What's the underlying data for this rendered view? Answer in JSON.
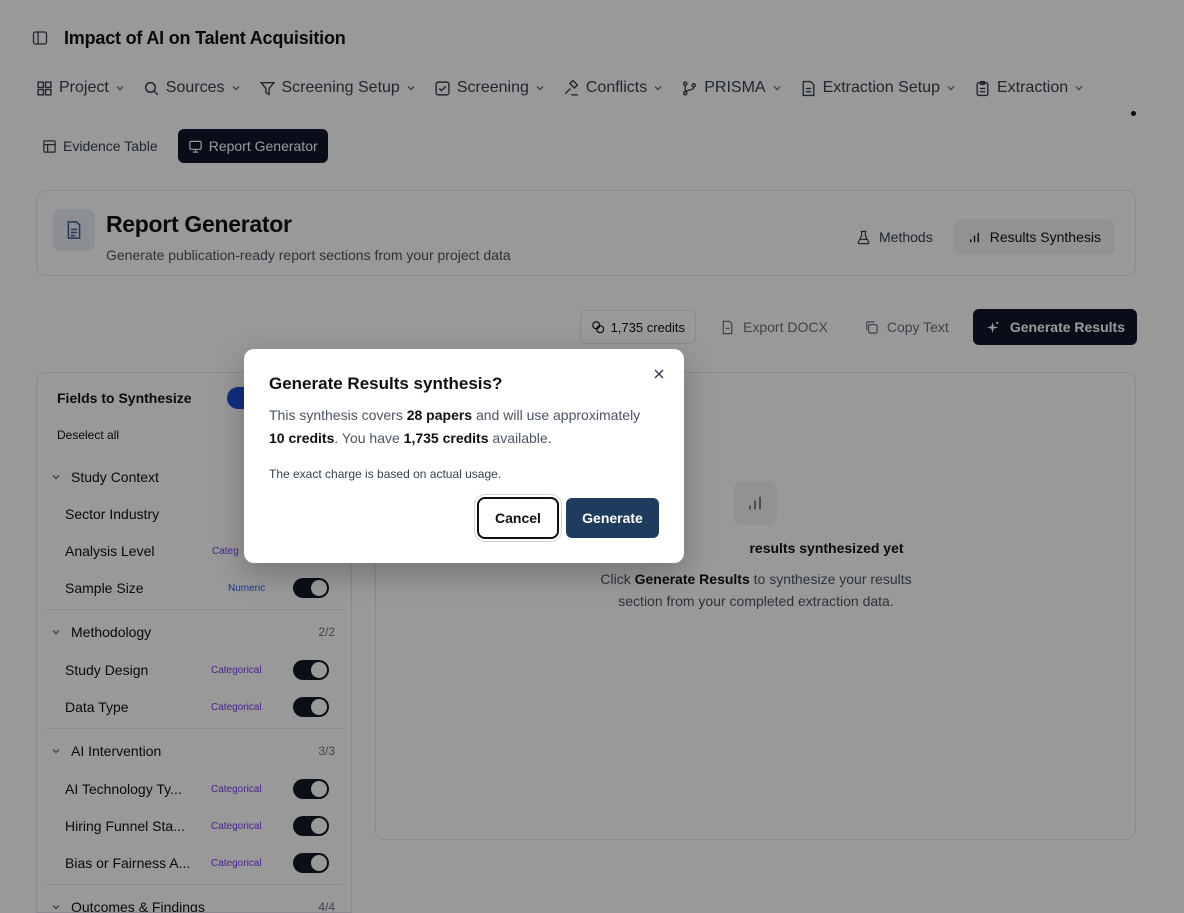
{
  "window": {
    "title": "Impact of AI on Talent Acquisition"
  },
  "nav": {
    "items": [
      {
        "label": "Project",
        "icon": "grid-icon"
      },
      {
        "label": "Sources",
        "icon": "search-icon"
      },
      {
        "label": "Screening Setup",
        "icon": "filter-icon"
      },
      {
        "label": "Screening",
        "icon": "checkbox-icon"
      },
      {
        "label": "Conflicts",
        "icon": "gavel-icon"
      },
      {
        "label": "PRISMA",
        "icon": "git-branch-icon"
      },
      {
        "label": "Extraction Setup",
        "icon": "file-text-icon"
      },
      {
        "label": "Extraction",
        "icon": "clipboard-icon"
      }
    ]
  },
  "subnav": {
    "evidence_table": "Evidence Table",
    "report_generator": "Report Generator"
  },
  "header": {
    "title": "Report Generator",
    "subtitle": "Generate publication-ready report sections from your project data",
    "tabs": [
      {
        "label": "Methods",
        "icon": "flask-icon",
        "active": false
      },
      {
        "label": "Results Synthesis",
        "icon": "bar-chart-icon",
        "active": true
      }
    ]
  },
  "toolbar": {
    "credits": "1,735 credits",
    "export": "Export DOCX",
    "copy": "Copy Text",
    "generate": "Generate Results"
  },
  "fields_panel": {
    "title": "Fields to Synthesize",
    "deselect_all": "Deselect all",
    "groups": [
      {
        "name": "Study Context",
        "count": "",
        "fields": [
          {
            "label": "Sector Industry",
            "type": ""
          },
          {
            "label": "Analysis Level",
            "type": "Categ"
          },
          {
            "label": "Sample Size",
            "type": "Numeric"
          }
        ]
      },
      {
        "name": "Methodology",
        "count": "2/2",
        "fields": [
          {
            "label": "Study Design",
            "type": "Categorical"
          },
          {
            "label": "Data Type",
            "type": "Categorical"
          }
        ]
      },
      {
        "name": "AI Intervention",
        "count": "3/3",
        "fields": [
          {
            "label": "AI Technology Ty...",
            "type": "Categorical"
          },
          {
            "label": "Hiring Funnel Sta...",
            "type": "Categorical"
          },
          {
            "label": "Bias or Fairness A...",
            "type": "Categorical"
          }
        ]
      },
      {
        "name": "Outcomes & Findings",
        "count": "4/4",
        "fields": []
      }
    ]
  },
  "empty_state": {
    "title": "results synthesized yet",
    "desc_prefix": "Click ",
    "desc_bold": "Generate Results",
    "desc_suffix": " to synthesize your results section from your completed extraction data."
  },
  "dialog": {
    "title": "Generate Results synthesis?",
    "body_1": "This synthesis covers ",
    "papers": "28 papers",
    "body_2": " and will use approximately ",
    "est_credits": "10 credits",
    "body_3": ". You have ",
    "have_credits": "1,735 credits",
    "body_4": " available.",
    "note": "The exact charge is based on actual usage.",
    "cancel": "Cancel",
    "generate": "Generate"
  }
}
